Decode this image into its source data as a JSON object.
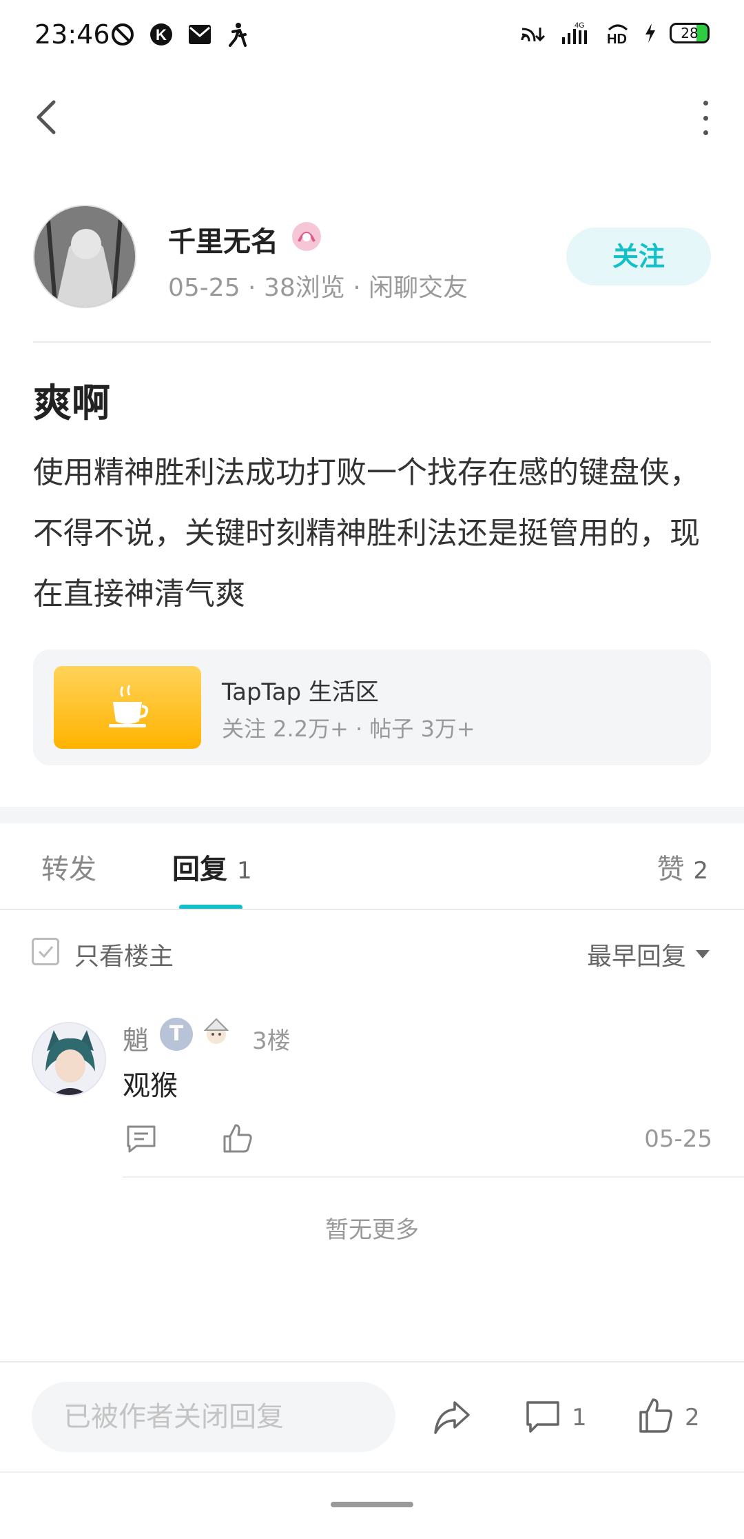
{
  "status_bar": {
    "time": "23:46",
    "left_icons": [
      "do-not-disturb-icon",
      "k-app-icon",
      "mail-icon",
      "accessibility-icon"
    ],
    "right_icons": [
      "cast-icon",
      "signal-4g-icon",
      "hd-icon",
      "charging-icon"
    ],
    "battery_level": "28"
  },
  "nav": {
    "back_icon": "chevron-left-icon",
    "more_icon": "more-vertical-icon"
  },
  "author": {
    "name": "千里无名",
    "meta": "05-25 · 38浏览 · 闲聊交友",
    "follow_label": "关注"
  },
  "post": {
    "title": "爽啊",
    "body": "使用精神胜利法成功打败一个找存在感的键盘侠，不得不说，关键时刻精神胜利法还是挺管用的，现在直接神清气爽"
  },
  "forum": {
    "name": "TapTap 生活区",
    "stats": "关注 2.2万+ · 帖子 3万+",
    "icon": "coffee-cup-icon"
  },
  "tabs": {
    "repost": "转发",
    "reply": "回复",
    "reply_count": "1",
    "like": "赞",
    "like_count": "2"
  },
  "filter": {
    "only_op_label": "只看楼主",
    "sort_label": "最早回复"
  },
  "comments": [
    {
      "name": "魈",
      "badge": "T",
      "floor": "3楼",
      "text": "观猴",
      "date": "05-25"
    }
  ],
  "no_more": "暂无更多",
  "bottom_bar": {
    "input_placeholder": "已被作者关闭回复",
    "comment_count": "1",
    "like_count": "2"
  },
  "colors": {
    "accent": "#14c0c8",
    "follow_bg": "#e5f7f8",
    "card_bg": "#f4f5f7",
    "forum_icon": "#ffc107"
  }
}
